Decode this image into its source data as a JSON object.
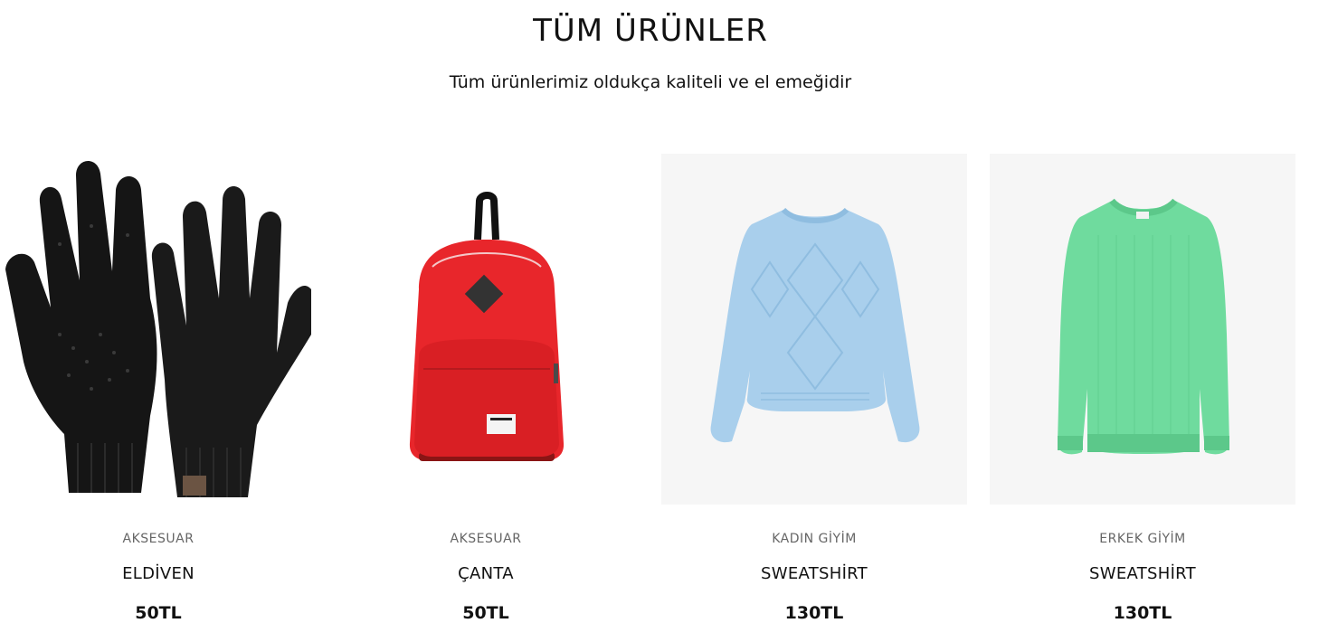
{
  "header": {
    "title": "TÜM ÜRÜNLER",
    "subtitle": "Tüm ürünlerimiz oldukça kaliteli ve el emeğidir"
  },
  "products": [
    {
      "category": "AKSESUAR",
      "name": "ELDİVEN",
      "price": "50TL",
      "image": "black-knit-gloves"
    },
    {
      "category": "AKSESUAR",
      "name": "ÇANTA",
      "price": "50TL",
      "image": "red-backpack"
    },
    {
      "category": "KADIN GİYİM",
      "name": "SWEATSHİRT",
      "price": "130TL",
      "image": "light-blue-knit-sweater"
    },
    {
      "category": "ERKEK GİYİM",
      "name": "SWEATSHİRT",
      "price": "130TL",
      "image": "mint-green-knit-sweater"
    }
  ],
  "colors": {
    "gloves": "#151515",
    "backpack": "#e8262b",
    "sweater_blue": "#a9cfec",
    "sweater_green": "#6fdb9e"
  }
}
